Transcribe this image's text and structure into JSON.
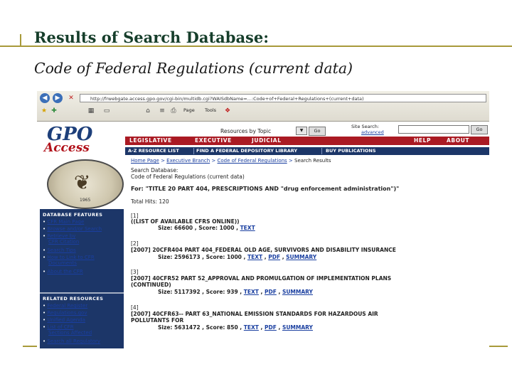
{
  "slide": {
    "title": "Results of Search Database:",
    "subtitle": "Code of Federal Regulations (current data)"
  },
  "browser": {
    "url": "http://frwebgate.access.gpo.gov/cgi-bin/multidb.cgi?WAISdbName=...:Code+of+Federal+Regulations+(current+data)",
    "toolbar_items": [
      "Page",
      "Tools"
    ]
  },
  "gpo": {
    "logo_line1": "GPO",
    "logo_line2": "Access",
    "topic_label": "Resources by Topic",
    "topic_go": "Go",
    "site_search_label": "Site Search:",
    "site_search_advanced": "advanced",
    "site_search_go": "Go",
    "nav": [
      "LEGISLATIVE",
      "EXECUTIVE",
      "JUDICIAL",
      "HELP",
      "ABOUT"
    ],
    "links": [
      "A-Z RESOURCE LIST",
      "FIND A FEDERAL DEPOSITORY LIBRARY",
      "BUY PUBLICATIONS"
    ],
    "seal_year": "1965"
  },
  "sidebar": {
    "features_heading": "DATABASE FEATURES",
    "features": [
      "CFR Main Page",
      "Browse and/or Search",
      "Retrieve by",
      "CFR Citation",
      "Search Tips",
      "How to Link to CFR",
      "Documents",
      "About the CFR"
    ],
    "resources_heading": "RELATED RESOURCES",
    "resources": [
      "Federal Register",
      "Regulations.gov",
      "Unified Agenda",
      "List of CFR",
      "Sections Affected",
      "Search all Regulatory"
    ]
  },
  "main": {
    "breadcrumb": [
      "Home Page",
      "Executive Branch",
      "Code of Federal Regulations",
      "Search Results"
    ],
    "db_label": "Search Database:",
    "db_name": "Code of Federal Regulations (current data)",
    "query": "For: \"TITLE 20 PART 404, PRESCRIPTIONS AND \"drug enforcement administration\")\"",
    "total_hits": "Total Hits: 120",
    "results": [
      {
        "num": "[1]",
        "line1": "((LIST OF AVAILABLE CFRS ONLINE))",
        "line2": "",
        "size": "Size: 66600 , Score: 1000 ,",
        "links": [
          "TEXT"
        ]
      },
      {
        "num": "[2]",
        "line1": "[2007] 20CFR404 PART 404_FEDERAL OLD AGE, SURVIVORS AND DISABILITY INSURANCE",
        "line2": "",
        "size": "Size: 2596173 , Score: 1000 ,",
        "links": [
          "TEXT",
          "PDF",
          "SUMMARY"
        ]
      },
      {
        "num": "[3]",
        "line1": "[2007] 40CFR52 PART 52_APPROVAL AND PROMULGATION OF IMPLEMENTATION PLANS",
        "line2": "(CONTINUED)",
        "size": "Size: 5117392 , Score: 939 ,",
        "links": [
          "TEXT",
          "PDF",
          "SUMMARY"
        ]
      },
      {
        "num": "[4]",
        "line1": "[2007] 40CFR63-- PART 63_NATIONAL EMISSION STANDARDS FOR HAZARDOUS AIR",
        "line2": "POLLUTANTS FOR",
        "size": "Size: 5631472 , Score: 850 ,",
        "links": [
          "TEXT",
          "PDF",
          "SUMMARY"
        ]
      }
    ]
  }
}
